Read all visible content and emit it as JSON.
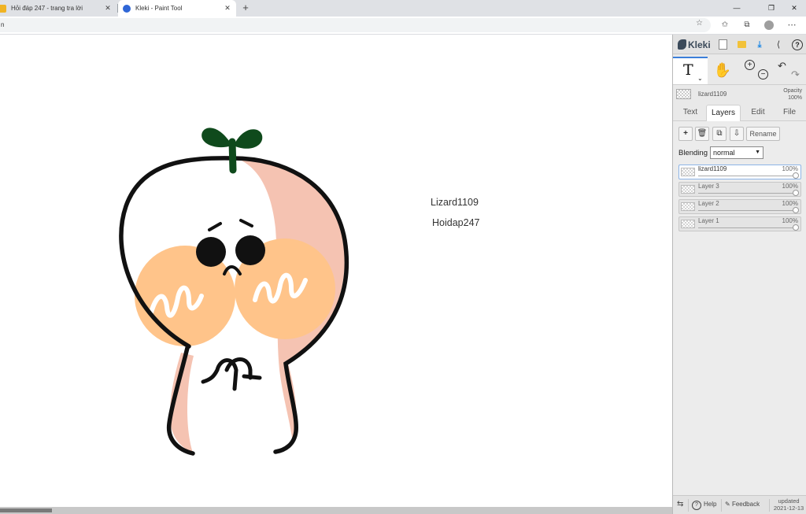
{
  "browser": {
    "tabs": [
      {
        "title": "Hỏi đáp 247 - trang tra lời",
        "close": "✕"
      },
      {
        "title": "Kleki - Paint Tool",
        "close": "✕"
      }
    ],
    "new_tab": "+",
    "window_controls": {
      "minimize": "—",
      "maximize": "❐",
      "close": "✕"
    },
    "address": "n"
  },
  "canvas": {
    "texts": [
      "Lizard1109",
      "Hoidap247"
    ],
    "colors": {
      "outline": "#111111",
      "blush": "#ffc48a",
      "shade": "#f5c3b2",
      "sprout": "#0f4a1c"
    }
  },
  "kleki": {
    "app_name": "Kleki",
    "active_layer_name": "lizard1109",
    "opacity_label": "Opacity",
    "opacity_value": "100%",
    "tabs": [
      "Text",
      "Layers",
      "Edit",
      "File"
    ],
    "active_tab": "Layers",
    "rename_label": "Rename",
    "blending_label": "Blending",
    "blending_value": "normal",
    "layers": [
      {
        "name": "lizard1109",
        "opacity": "100%",
        "active": true
      },
      {
        "name": "Layer 3",
        "opacity": "100%",
        "active": false
      },
      {
        "name": "Layer 2",
        "opacity": "100%",
        "active": false
      },
      {
        "name": "Layer 1",
        "opacity": "100%",
        "active": false
      }
    ],
    "footer": {
      "help": "Help",
      "feedback": "Feedback",
      "updated_label": "updated",
      "updated_date": "2021-12-13"
    }
  }
}
